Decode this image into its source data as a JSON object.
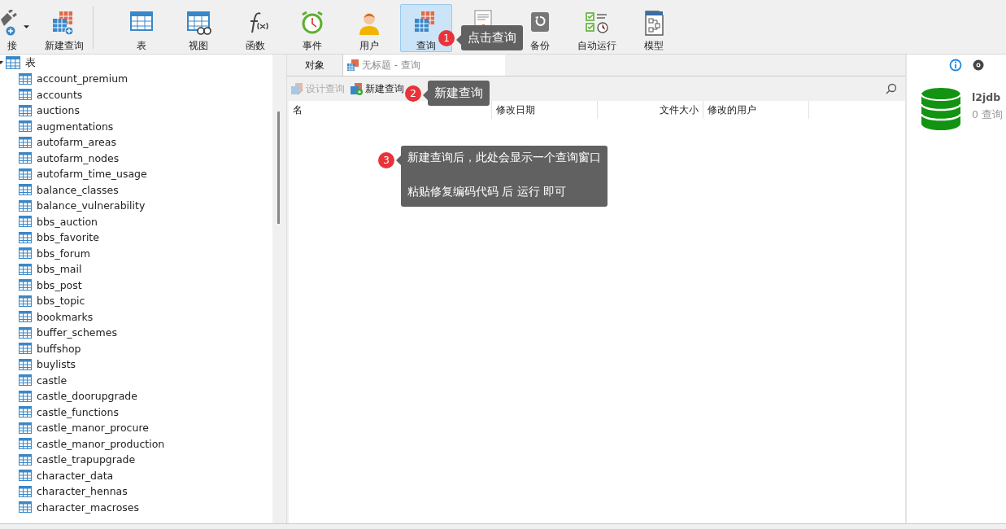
{
  "toolbar": {
    "items": [
      {
        "kind": "connect",
        "label": "接",
        "selected": false,
        "dropdown": true
      },
      {
        "kind": "new-query",
        "label": "新建查询",
        "selected": false
      },
      {
        "kind": "table",
        "label": "表",
        "selected": false
      },
      {
        "kind": "view",
        "label": "视图",
        "selected": false
      },
      {
        "kind": "function",
        "label": "函数",
        "selected": false
      },
      {
        "kind": "event",
        "label": "事件",
        "selected": false
      },
      {
        "kind": "user",
        "label": "用户",
        "selected": false
      },
      {
        "kind": "query",
        "label": "查询",
        "selected": true
      },
      {
        "kind": "report",
        "selected": false
      },
      {
        "kind": "backup",
        "label": "备份",
        "selected": false
      },
      {
        "kind": "autorun",
        "label": "自动运行",
        "selected": false
      },
      {
        "kind": "model",
        "label": "模型",
        "selected": false
      }
    ]
  },
  "sidebar": {
    "header": {
      "label": "表",
      "expanded": true
    },
    "items": [
      "account_premium",
      "accounts",
      "auctions",
      "augmentations",
      "autofarm_areas",
      "autofarm_nodes",
      "autofarm_time_usage",
      "balance_classes",
      "balance_vulnerability",
      "bbs_auction",
      "bbs_favorite",
      "bbs_forum",
      "bbs_mail",
      "bbs_post",
      "bbs_topic",
      "bookmarks",
      "buffer_schemes",
      "buffshop",
      "buylists",
      "castle",
      "castle_doorupgrade",
      "castle_functions",
      "castle_manor_procure",
      "castle_manor_production",
      "castle_trapupgrade",
      "character_data",
      "character_hennas",
      "character_macroses"
    ]
  },
  "tabs": [
    {
      "label": "对象",
      "selected": true,
      "kind": "plain"
    },
    {
      "label": "无标题 - 查询",
      "selected": false,
      "kind": "query"
    }
  ],
  "actions": [
    {
      "label": "设计查询",
      "disabled": true
    },
    {
      "label": "新建查询",
      "disabled": false
    }
  ],
  "table": {
    "columns": [
      {
        "label": "名"
      },
      {
        "label": "修改日期"
      },
      {
        "label": "文件大小"
      },
      {
        "label": "修改的用户"
      }
    ]
  },
  "info_panel": {
    "name": "l2jdb",
    "count": "0 查询"
  },
  "callouts": [
    {
      "number": "1",
      "lines": [
        "点击查询"
      ]
    },
    {
      "number": "2",
      "lines": [
        "新建查询"
      ]
    },
    {
      "number": "3",
      "lines": [
        "新建查询后，此处会显示一个查询窗口",
        "粘贴修复编码代码 后 运行 即可"
      ]
    }
  ]
}
